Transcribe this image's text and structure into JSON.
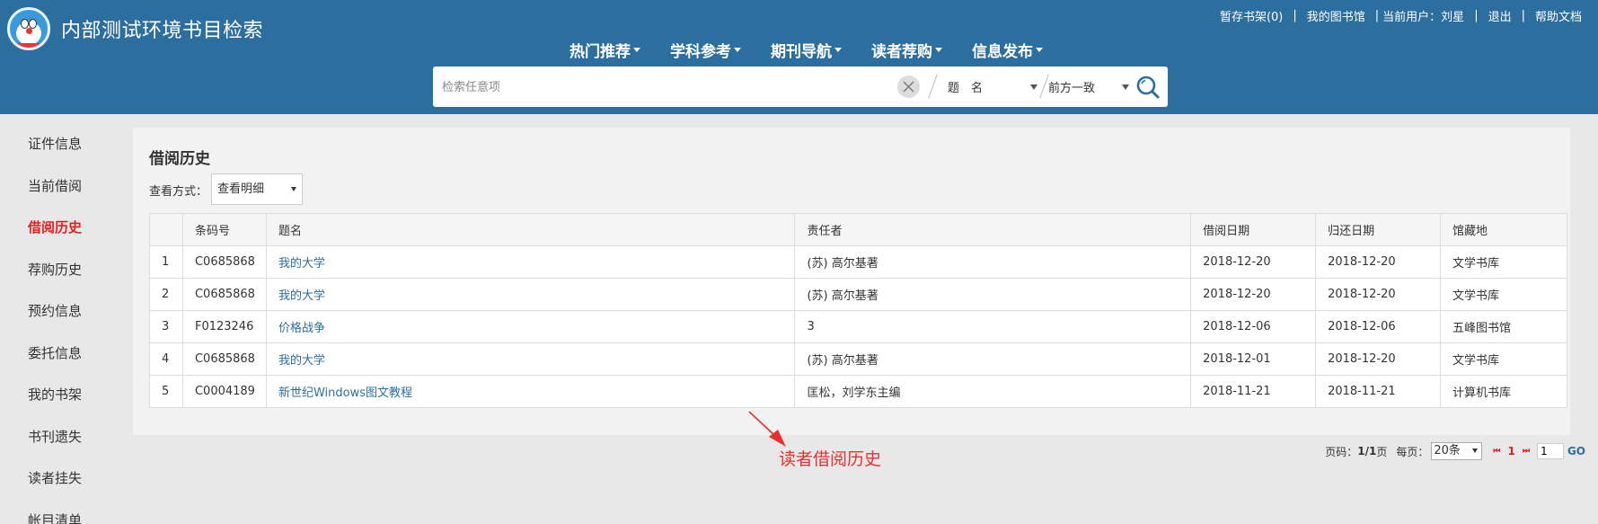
{
  "header": {
    "title": "内部测试环境书目检索",
    "toplinks": {
      "shelf": "暂存书架(0)",
      "library": "我的图书馆",
      "user_label": "当前用户：",
      "user_name": "刘星",
      "logout": "退出",
      "help": "帮助文档",
      "separator": "|"
    },
    "nav": [
      "热门推荐",
      "学科参考",
      "期刊导航",
      "读者荐购",
      "信息发布"
    ]
  },
  "search": {
    "placeholder": "检索任意项",
    "field": "题　名",
    "match": "前方一致"
  },
  "sidebar": {
    "items": [
      "证件信息",
      "当前借阅",
      "借阅历史",
      "荐购历史",
      "预约信息",
      "委托信息",
      "我的书架",
      "书刊遗失",
      "读者挂失",
      "帐目清单"
    ],
    "active": "借阅历史"
  },
  "panel": {
    "title": "借阅历史",
    "view_label": "查看方式：",
    "view_value": "查看明细"
  },
  "table": {
    "headers": [
      "",
      "条码号",
      "题名",
      "责任者",
      "借阅日期",
      "归还日期",
      "馆藏地"
    ],
    "rows": [
      [
        "1",
        "C0685868",
        "我的大学",
        "(苏) 高尔基著",
        "2018-12-20",
        "2018-12-20",
        "文学书库"
      ],
      [
        "2",
        "C0685868",
        "我的大学",
        "(苏) 高尔基著",
        "2018-12-20",
        "2018-12-20",
        "文学书库"
      ],
      [
        "3",
        "F0123246",
        "价格战争",
        "3",
        "2018-12-06",
        "2018-12-06",
        "五峰图书馆"
      ],
      [
        "4",
        "C0685868",
        "我的大学",
        "(苏) 高尔基著",
        "2018-12-01",
        "2018-12-20",
        "文学书库"
      ],
      [
        "5",
        "C0004189",
        "新世纪Windows图文教程",
        "匡松，刘学东主编",
        "2018-11-21",
        "2018-11-21",
        "计算机书库"
      ]
    ]
  },
  "annotation": "读者借阅历史",
  "pager": {
    "page_label": "页码：",
    "page_value": "1/1",
    "page_suffix": "页",
    "per_page_label": "每页：",
    "per_page_value": "20条",
    "first": "⏮",
    "current": "1",
    "last": "⏭",
    "input_value": "1",
    "go": "GO"
  },
  "colors": {
    "header_bg": "#2c6f9f",
    "active_red": "#e02020",
    "link_blue": "#2c6f9f",
    "annotation_red": "#e83030"
  }
}
